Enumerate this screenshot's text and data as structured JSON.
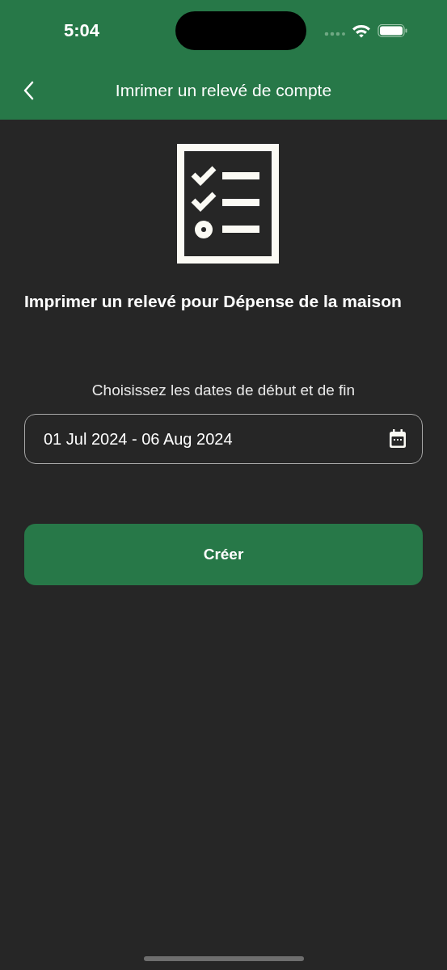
{
  "status_bar": {
    "time": "5:04"
  },
  "nav_bar": {
    "title": "Imrimer un relevé de compte"
  },
  "heading": "Imprimer un relevé pour Dépense de la maison",
  "date_range": {
    "label": "Choisissez les dates de début et de fin",
    "value": "01 Jul 2024 - 06 Aug 2024"
  },
  "buttons": [
    "Créer"
  ]
}
